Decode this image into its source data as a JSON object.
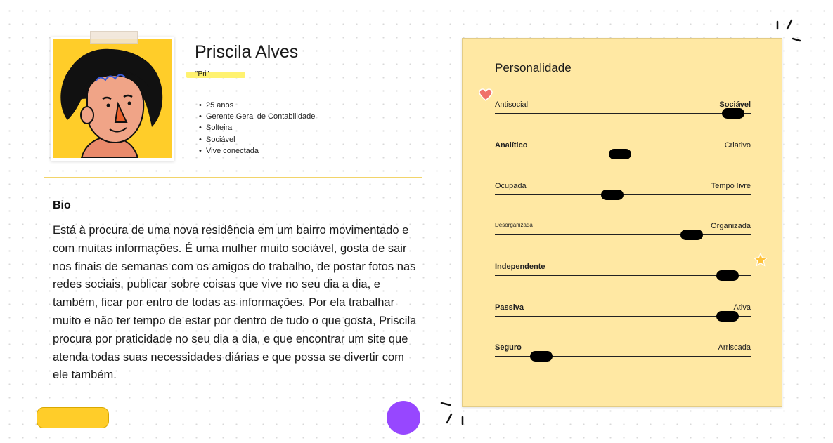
{
  "profile": {
    "name": "Priscila Alves",
    "nickname": "\"Pri\"",
    "traits": [
      "25 anos",
      "Gerente Geral de Contabilidade",
      "Solteira",
      "Sociável",
      "Vive conectada"
    ]
  },
  "bio": {
    "title": "Bio",
    "text": "Está à procura de uma nova residência em um bairro movimentado e com muitas informações. É uma mulher muito sociável, gosta de sair nos finais de semanas com os amigos do trabalho, de postar fotos nas redes sociais, publicar sobre coisas que vive no seu dia a dia, e também, ficar por entro de todas as informações. Por ela trabalhar muito e não ter tempo de estar por dentro de tudo o que gosta, Priscila procura por praticidade no seu dia a dia, e que encontrar um site que atenda todas suas necessidades diárias e que possa se divertir com ele também."
  },
  "personality": {
    "title": "Personalidade",
    "sliders": [
      {
        "left": "Antisocial",
        "right": "Sociável",
        "value": 0.93
      },
      {
        "left": "Analítico",
        "right": "Criativo",
        "value": 0.49
      },
      {
        "left": "Ocupada",
        "right": "Tempo livre",
        "value": 0.46
      },
      {
        "left": "Desorganizada",
        "right": "Organizada",
        "value": 0.77
      },
      {
        "left": "Independente",
        "right": "",
        "value": 0.91
      },
      {
        "left": "Passiva",
        "right": "Ativa",
        "value": 0.91
      },
      {
        "left": "Seguro",
        "right": "Arriscada",
        "value": 0.18
      }
    ]
  },
  "colors": {
    "accent_yellow": "#ffcd29",
    "card_bg": "#ffe8a3",
    "purple": "#9747ff",
    "heart": "#f0706a"
  },
  "icons": [
    "heart-icon",
    "star-icon",
    "sparkle-icon",
    "avatar-illustration"
  ]
}
